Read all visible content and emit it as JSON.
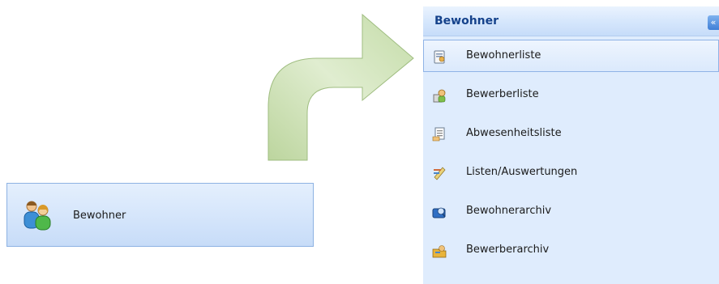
{
  "nav_button": {
    "label": "Bewohner",
    "icon": "people-icon"
  },
  "panel": {
    "title": "Bewohner",
    "collapse_glyph": "«",
    "items": [
      {
        "label": "Bewohnerliste",
        "icon": "resident-list-icon",
        "selected": true
      },
      {
        "label": "Bewerberliste",
        "icon": "applicant-list-icon",
        "selected": false
      },
      {
        "label": "Abwesenheitsliste",
        "icon": "absence-list-icon",
        "selected": false
      },
      {
        "label": "Listen/Auswertungen",
        "icon": "reports-icon",
        "selected": false
      },
      {
        "label": "Bewohnerarchiv",
        "icon": "resident-archive-icon",
        "selected": false
      },
      {
        "label": "Bewerberarchiv",
        "icon": "applicant-archive-icon",
        "selected": false
      }
    ]
  },
  "colors": {
    "header_text": "#15428b",
    "panel_bg": "#dfecfd",
    "button_border": "#8db2e3",
    "arrow_green": "#a9c98a"
  }
}
